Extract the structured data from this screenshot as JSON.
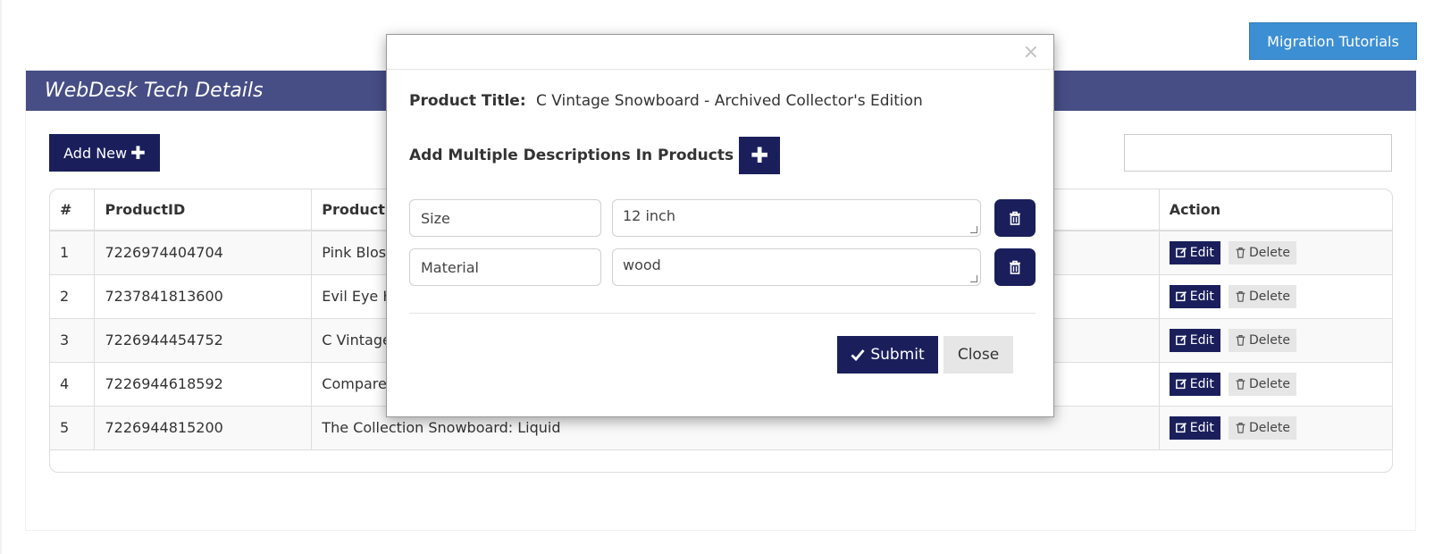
{
  "header": {
    "migration_label": "Migration Tutorials",
    "card_title": "WebDesk Tech Details",
    "add_new_label": "Add New",
    "search_value": ""
  },
  "table": {
    "columns": [
      "#",
      "ProductID",
      "Product T",
      "Action"
    ],
    "rows": [
      {
        "num": "1",
        "id": "7226974404704",
        "title": "Pink Blos"
      },
      {
        "num": "2",
        "id": "7237841813600",
        "title": "Evil Eye H"
      },
      {
        "num": "3",
        "id": "7226944454752",
        "title": "C Vintage"
      },
      {
        "num": "4",
        "id": "7226944618592",
        "title": "Compare"
      },
      {
        "num": "5",
        "id": "7226944815200",
        "title": "The Collection Snowboard: Liquid"
      }
    ],
    "edit_label": "Edit",
    "delete_label": "Delete"
  },
  "modal": {
    "close_x": "×",
    "product_title_label": "Product Title:",
    "product_title_value": "C Vintage Snowboard - Archived Collector's Edition",
    "desc_heading": "Add Multiple Descriptions In Products",
    "descriptions": [
      {
        "key": "Size",
        "value": "12 inch"
      },
      {
        "key": "Material",
        "value": "wood"
      }
    ],
    "submit_label": "Submit",
    "close_label": "Close"
  },
  "colors": {
    "navy": "#1a1f5c",
    "header_bar": "#474e86",
    "migration_blue": "#3d8fd4"
  },
  "icons": {
    "plus": "plus-icon",
    "edit": "edit-icon",
    "delete": "trash-icon",
    "submit": "check-icon"
  }
}
